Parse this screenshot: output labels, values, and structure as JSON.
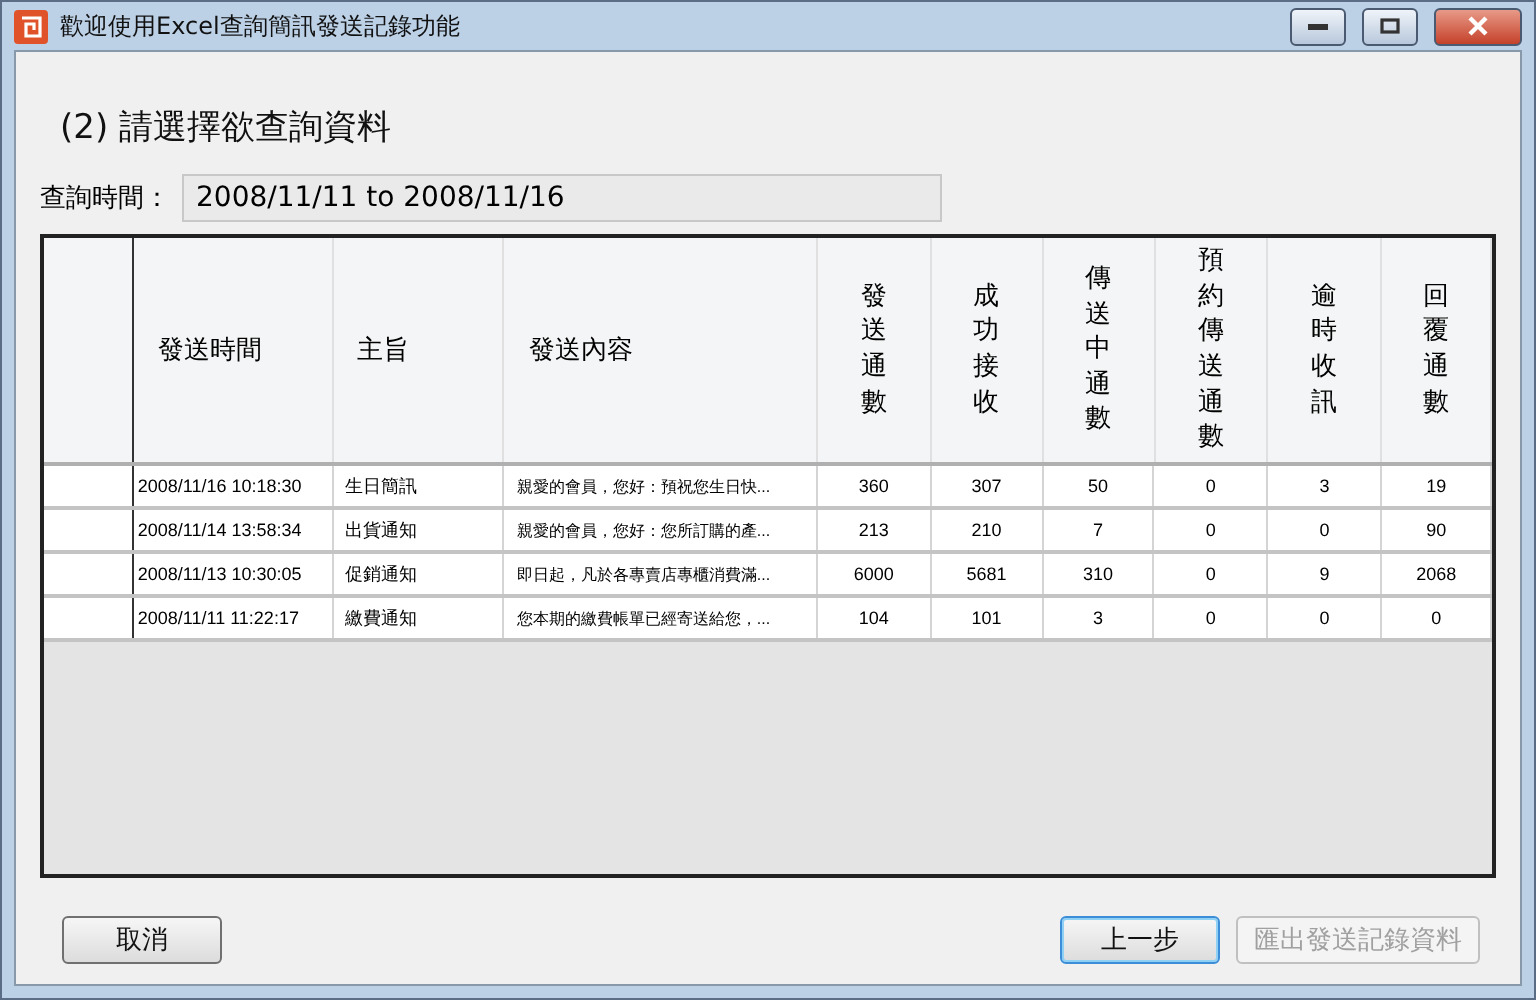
{
  "window": {
    "title": "歡迎使用Excel查詢簡訊發送記錄功能"
  },
  "heading": "(2) 請選擇欲查詢資料",
  "query": {
    "label": "查詢時間：",
    "value": "2008/11/11 to 2008/11/16"
  },
  "table": {
    "columns": [
      {
        "label": "發送時間",
        "kind": "horizontal"
      },
      {
        "label": "主旨",
        "kind": "horizontal"
      },
      {
        "label": "發送內容",
        "kind": "horizontal"
      },
      {
        "label": "發送通數",
        "kind": "vertical"
      },
      {
        "label": "成功接收",
        "kind": "vertical"
      },
      {
        "label": "傳送中通數",
        "kind": "vertical"
      },
      {
        "label": "預約傳送通數",
        "kind": "vertical"
      },
      {
        "label": "逾時收訊",
        "kind": "vertical"
      },
      {
        "label": "回覆通數",
        "kind": "vertical"
      }
    ],
    "rows": [
      [
        "2008/11/16 10:18:30",
        "生日簡訊",
        "親愛的會員，您好：預祝您生日快...",
        "360",
        "307",
        "50",
        "0",
        "3",
        "19"
      ],
      [
        "2008/11/14 13:58:34",
        "出貨通知",
        "親愛的會員，您好：您所訂購的產...",
        "213",
        "210",
        "7",
        "0",
        "0",
        "90"
      ],
      [
        "2008/11/13 10:30:05",
        "促銷通知",
        "即日起，凡於各專賣店專櫃消費滿...",
        "6000",
        "5681",
        "310",
        "0",
        "9",
        "2068"
      ],
      [
        "2008/11/11 11:22:17",
        "繳費通知",
        "您本期的繳費帳單已經寄送給您，...",
        "104",
        "101",
        "3",
        "0",
        "0",
        "0"
      ]
    ]
  },
  "buttons": [
    {
      "label": "取消",
      "disabled": false,
      "focused": false
    },
    {
      "label": "上一步",
      "disabled": false,
      "focused": true
    },
    {
      "label": "匯出發送記錄資料",
      "disabled": true,
      "focused": false
    }
  ]
}
